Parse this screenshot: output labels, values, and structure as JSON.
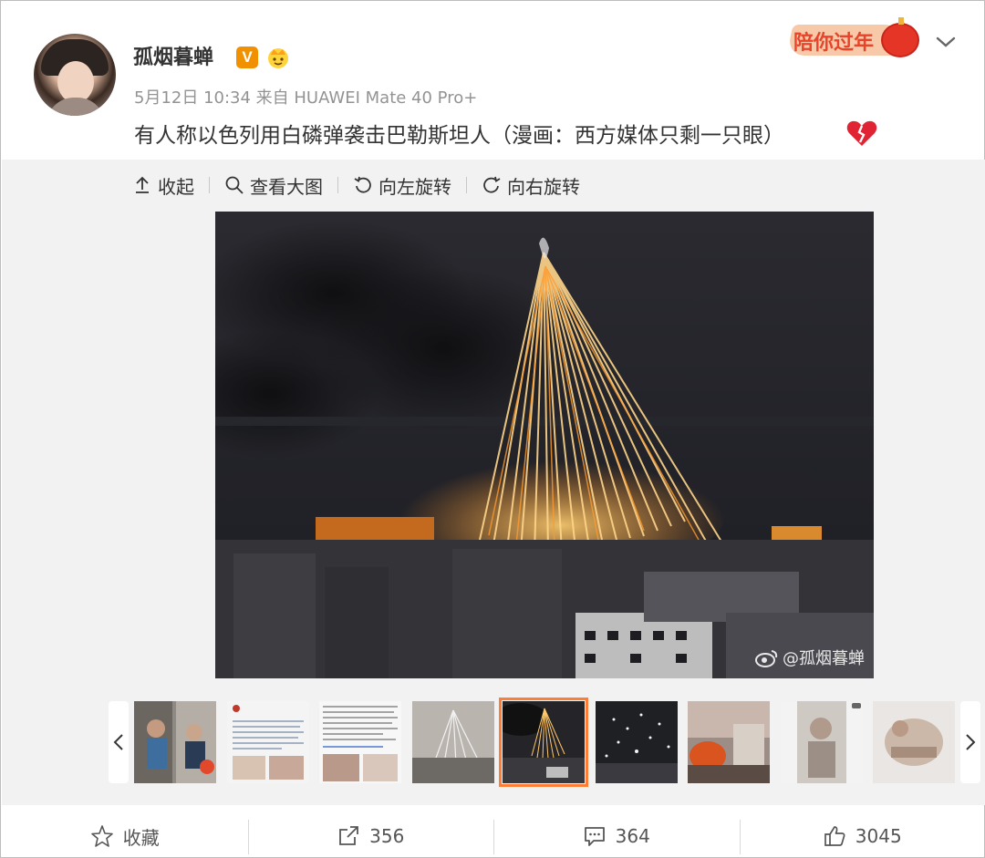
{
  "author": {
    "name": "孤烟暮蝉",
    "verified_badge": "V",
    "meta": "5月12日 10:34 来自 HUAWEI Mate 40 Pro+"
  },
  "badge": {
    "text": "陪你过年"
  },
  "post": {
    "text": "有人称以色列用白磷弹袭击巴勒斯坦人（漫画：西方媒体只剩一只眼）",
    "emoji": "broken-heart-icon"
  },
  "toolbar": {
    "collapse": "收起",
    "view_large": "查看大图",
    "rotate_left": "向左旋转",
    "rotate_right": "向右旋转"
  },
  "image": {
    "watermark": "@孤烟暮蝉"
  },
  "thumbnails": {
    "count": 9,
    "active_index": 4,
    "small_text_5": "confirmed that the injuries that they are seeing are indeed cause by white phosphorus ! This is an internationally banned weapon ! This is another war crime committed by Israel !"
  },
  "actions": {
    "favorite": "收藏",
    "repost_count": "356",
    "comment_count": "364",
    "like_count": "3045"
  },
  "colors": {
    "accent": "#ff7d35",
    "badge": "#f29100",
    "festival": "#e8432b"
  }
}
